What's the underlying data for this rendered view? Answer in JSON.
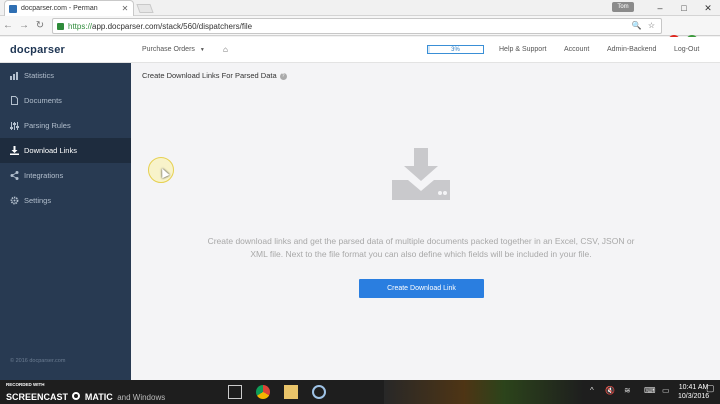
{
  "browser": {
    "tab_title": "docparser.com - Perman",
    "url_scheme": "https://",
    "url_rest": "app.docparser.com/stack/560/dispatchers/file",
    "user_badge": "Tom",
    "window_controls": [
      "–",
      "□",
      "✕"
    ]
  },
  "header": {
    "logo": "docparser",
    "stack_selector": "Purchase Orders",
    "progress_text": "3%",
    "progress_fraction": 0.03,
    "nav_items": [
      "Help & Support",
      "Account",
      "Admin-Backend",
      "Log-Out"
    ]
  },
  "sidebar": {
    "items": [
      {
        "label": "Statistics",
        "icon": "bar-chart-icon"
      },
      {
        "label": "Documents",
        "icon": "document-icon"
      },
      {
        "label": "Parsing Rules",
        "icon": "sliders-icon"
      },
      {
        "label": "Download Links",
        "icon": "download-icon"
      },
      {
        "label": "Integrations",
        "icon": "share-icon"
      },
      {
        "label": "Settings",
        "icon": "gear-icon"
      }
    ],
    "active_index": 3,
    "copyright": "© 2016 docparser.com"
  },
  "main": {
    "title": "Create Download Links For Parsed Data",
    "help_icon": "?",
    "description": "Create download links and get the parsed data of multiple documents packed together in an Excel, CSV, JSON or XML file. Next to the file format you can also define which fields will be included in your file.",
    "cta_label": "Create Download Link"
  },
  "taskbar": {
    "watermark_small": "RECORDED WITH",
    "watermark_big": "SCREENCAST",
    "watermark_mid": "MATIC",
    "watermark_rest": "and Windows",
    "time": "10:41 AM",
    "date": "10/3/2016"
  },
  "colors": {
    "sidebar_bg": "#283a52",
    "sidebar_active": "#1e2c3e",
    "accent": "#2a7ee0"
  }
}
